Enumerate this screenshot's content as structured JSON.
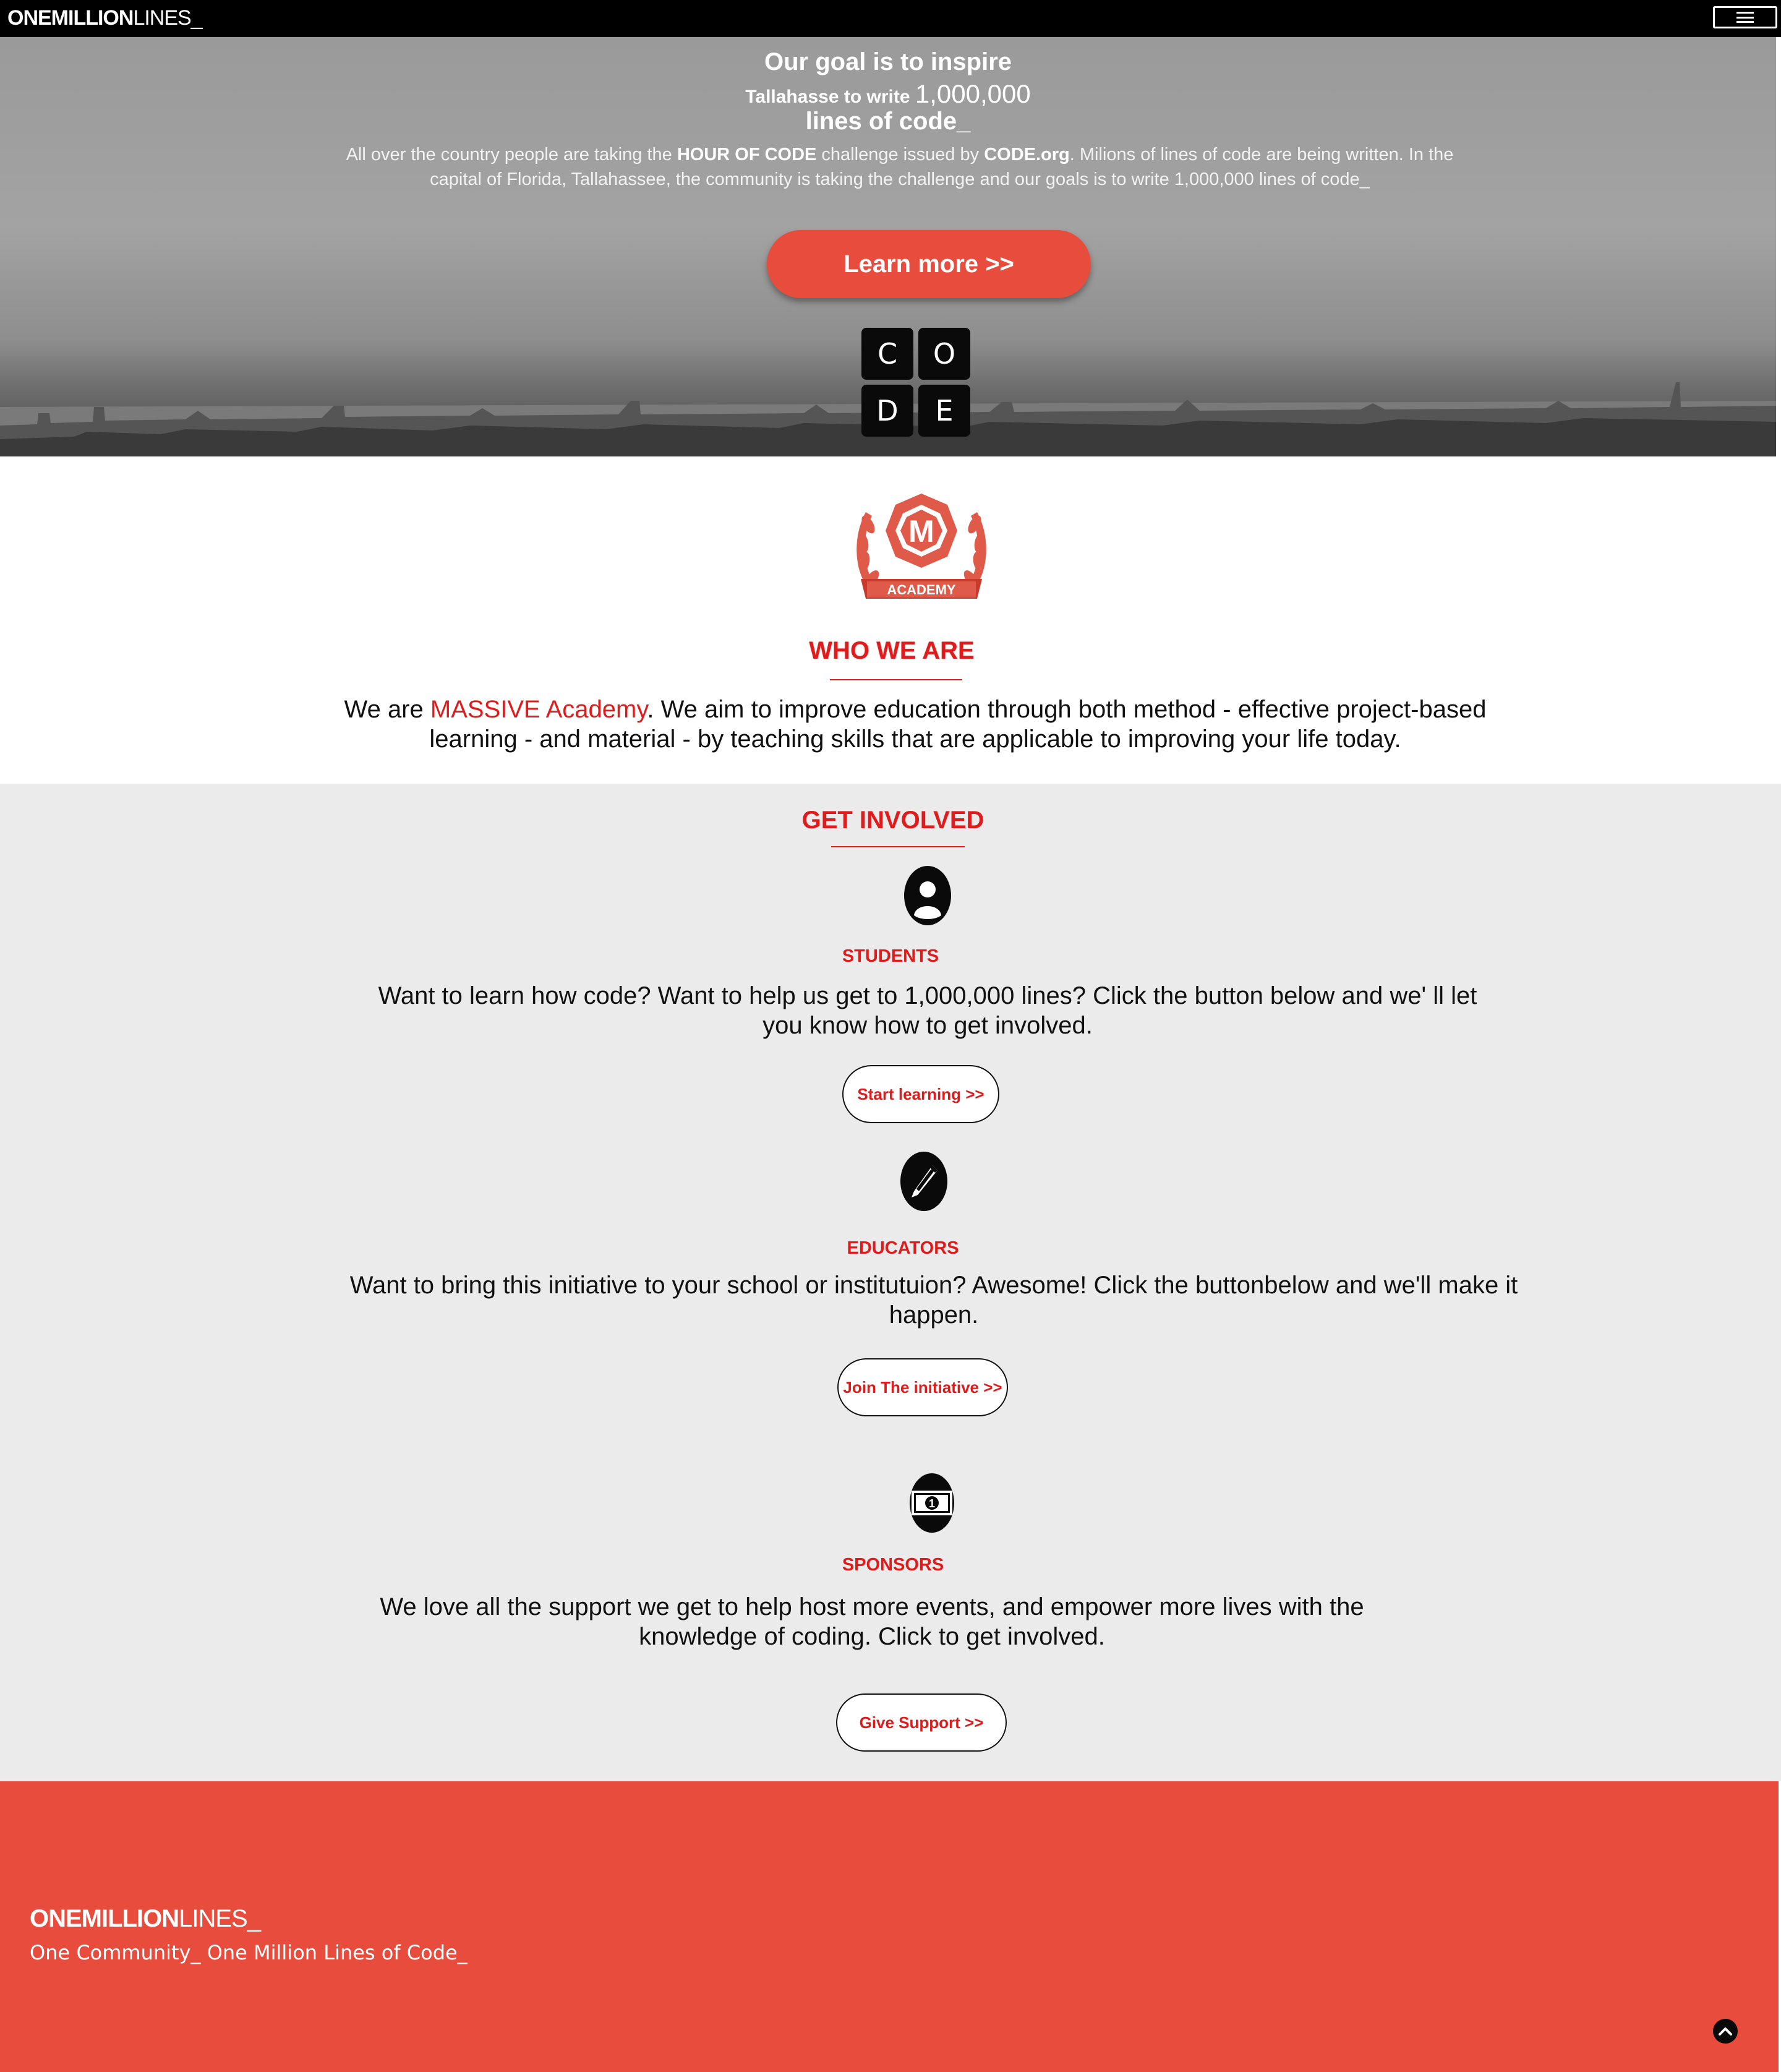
{
  "nav": {
    "brand_bold": "ONEMILLION",
    "brand_light": "LINES_",
    "menu_icon": "hamburger-icon"
  },
  "hero": {
    "line1": "Our goal is to inspire",
    "line2_prefix": "Tallahasse to write ",
    "line2_number": "1,000,000",
    "line3": "lines of code_",
    "desc_part1": "All over the country people are taking the ",
    "desc_bold1": "HOUR OF CODE",
    "desc_part2": " challenge issued by ",
    "desc_bold2": "CODE.org",
    "desc_part3": ". Milions of lines of code are being written. In the capital of Florida, Tallahassee, the community is taking the challenge and our goals is to write 1,000,000 lines of code_",
    "button": "Learn more >>",
    "code_letters": [
      "C",
      "O",
      "D",
      "E"
    ]
  },
  "who": {
    "badge_letter": "M",
    "badge_text": "ACADEMY",
    "title": "WHO WE ARE",
    "text_prefix": "We are ",
    "text_highlight": "MASSIVE Academy",
    "text_rest": ". We aim to improve education through both method - effective project-based learning - and material - by teaching skills that are applicable to improving your life today."
  },
  "involved": {
    "title": "GET INVOLVED",
    "students": {
      "icon": "user-icon",
      "title": "STUDENTS",
      "text": "Want to learn how code? Want to help us get to 1,000,000 lines? Click the button below and we' ll let you know how to get involved.",
      "button": "Start learning >>"
    },
    "educators": {
      "icon": "pencil-icon",
      "title": "EDUCATORS",
      "text": "Want to bring this initiative to your school or institutuion? Awesome! Click the buttonbelow and we'll make it happen.",
      "button": "Join The initiative >>"
    },
    "sponsors": {
      "icon": "money-icon",
      "title": "SPONSORS",
      "text": "We love all the support we get to help host more events, and empower more lives with the knowledge of coding. Click to get involved.",
      "button": "Give Support >>"
    }
  },
  "footer": {
    "brand_bold": "ONEMILLION",
    "brand_light": "LINES_",
    "tagline": "One Community_ One Million Lines of Code_",
    "to_top_icon": "chevron-up-icon"
  },
  "colors": {
    "accent": "#e84c3d",
    "title_red": "#e01b1b",
    "nav_bg": "#000000",
    "section_bg": "#ebebeb"
  }
}
